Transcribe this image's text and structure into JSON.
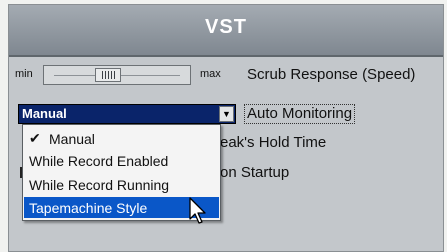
{
  "window": {
    "title": "VST"
  },
  "scrub": {
    "min_label": "min",
    "max_label": "max",
    "label": "Scrub Response (Speed)",
    "slider_position_percent": 46
  },
  "auto_monitoring": {
    "selected_value": "Manual",
    "label": "Auto Monitoring",
    "menu_items": [
      {
        "label": "Manual",
        "checked": true
      },
      {
        "label": "While Record Enabled",
        "checked": false
      },
      {
        "label": "While Record Running",
        "checked": false
      },
      {
        "label": "Tapemachine Style",
        "checked": false,
        "highlighted": true
      }
    ]
  },
  "peak_hold": {
    "label_visible": "eak's Hold Time"
  },
  "startup": {
    "label_visible": "on Startup"
  },
  "icons": {
    "dropdown_arrow": "triangle-down-icon",
    "check_mark": "check-icon",
    "cursor": "arrow-cursor-icon"
  },
  "colors": {
    "highlight": "#0a57c8",
    "dropdown_bg": "#0a246a",
    "title_bar": "#8e959c"
  }
}
